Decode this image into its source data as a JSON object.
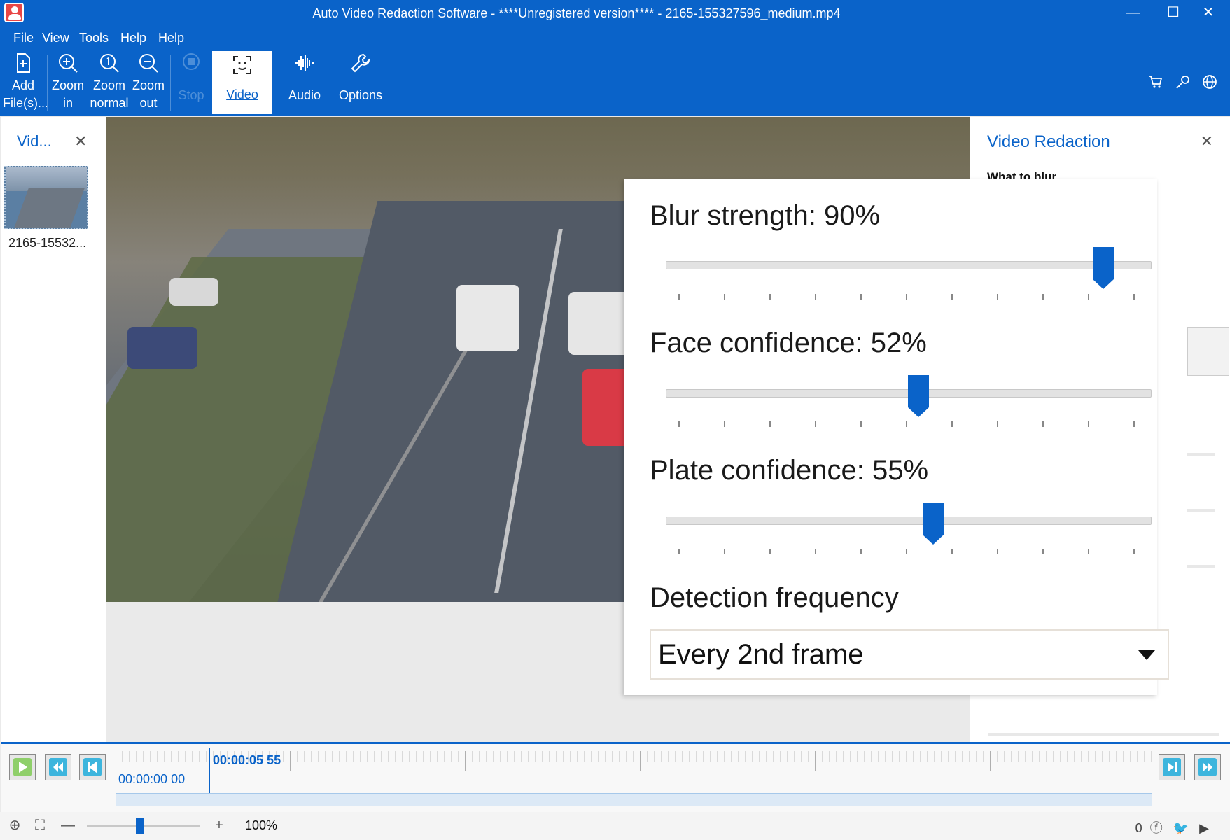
{
  "window": {
    "title": "Auto Video Redaction Software - ****Unregistered version**** - 2165-155327596_medium.mp4",
    "controls": [
      "—",
      "☐",
      "✕"
    ]
  },
  "menu": [
    "File",
    "View",
    "Tools",
    "Help",
    "Help"
  ],
  "toolbar": {
    "add_files": [
      "Add",
      "File(s)..."
    ],
    "zoom_in": [
      "Zoom",
      "in"
    ],
    "zoom_normal": [
      "Zoom",
      "normal"
    ],
    "zoom_out": [
      "Zoom",
      "out"
    ],
    "stop": "Stop",
    "video": "Video",
    "audio": "Audio",
    "options": "Options",
    "right_icons": [
      "cart-icon",
      "key-icon",
      "globe-icon"
    ]
  },
  "left_panel": {
    "title": "Vid...",
    "file_label": "2165-15532..."
  },
  "right_panel": {
    "title": "Video Redaction",
    "subtitle": "What to blur"
  },
  "settings": {
    "blur_label": "Blur strength: 90%",
    "blur_value": 90,
    "face_label": "Face confidence: 52%",
    "face_value": 52,
    "plate_label": "Plate confidence: 55%",
    "plate_value": 55,
    "frequency_label": "Detection frequency",
    "frequency_value": "Every 2nd frame"
  },
  "timeline": {
    "start_time": "00:00:00 00",
    "current_time": "00:00:05 55"
  },
  "status": {
    "zoom": "100%",
    "counter": "0"
  },
  "colors": {
    "brand": "#0a63c9",
    "panel": "#ffffff"
  }
}
